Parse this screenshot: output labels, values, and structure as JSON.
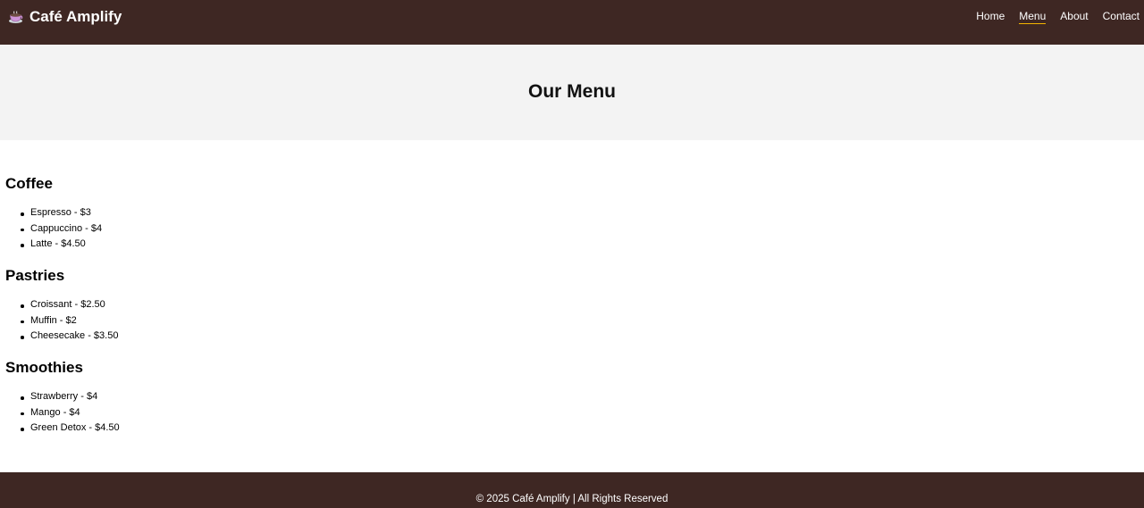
{
  "header": {
    "brand_icon": "coffee-cup-icon",
    "brand_name": "Café Amplify",
    "nav": [
      {
        "label": "Home",
        "active": false
      },
      {
        "label": "Menu",
        "active": true
      },
      {
        "label": "About",
        "active": false
      },
      {
        "label": "Contact",
        "active": false
      }
    ],
    "colors": {
      "background": "#3e2723",
      "active_underline": "#f4b400"
    }
  },
  "hero": {
    "title": "Our Menu"
  },
  "menu": {
    "sections": [
      {
        "title": "Coffee",
        "items": [
          "Espresso - $3",
          "Cappuccino - $4",
          "Latte - $4.50"
        ]
      },
      {
        "title": "Pastries",
        "items": [
          "Croissant - $2.50",
          "Muffin - $2",
          "Cheesecake - $3.50"
        ]
      },
      {
        "title": "Smoothies",
        "items": [
          "Strawberry - $4",
          "Mango - $4",
          "Green Detox - $4.50"
        ]
      }
    ]
  },
  "footer": {
    "text": "© 2025 Café Amplify | All Rights Reserved"
  }
}
